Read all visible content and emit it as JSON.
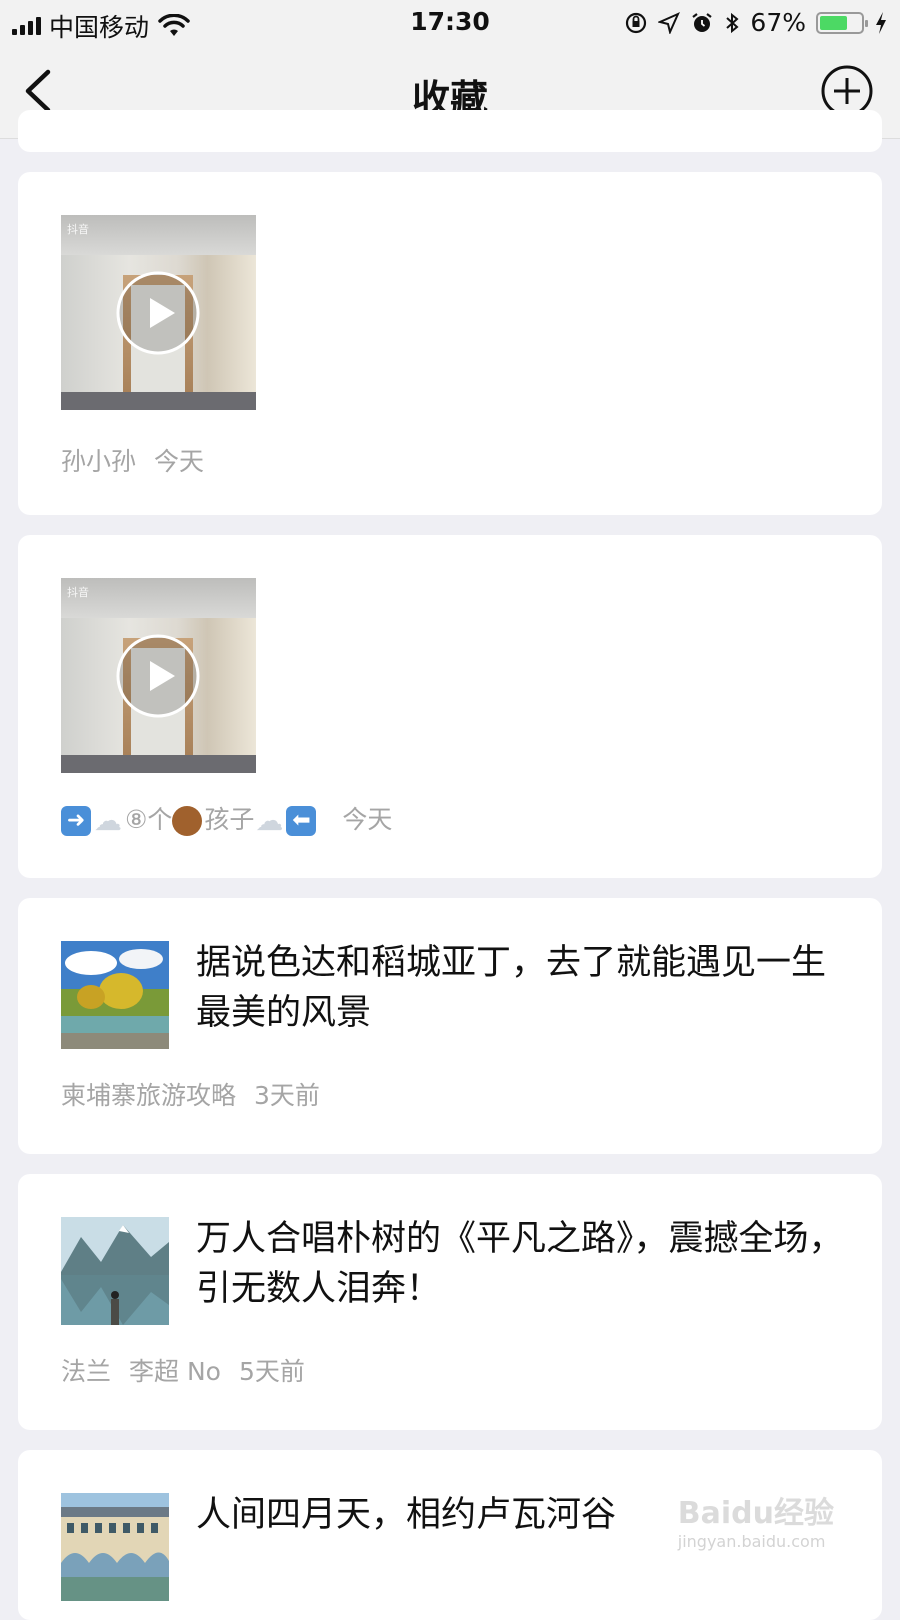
{
  "status_bar": {
    "carrier": "中国移动",
    "time": "17:30",
    "battery": "67%",
    "battery_level": 0.67
  },
  "nav": {
    "title": "收藏"
  },
  "items": [
    {
      "type": "video",
      "thumb_watermark": "抖音",
      "author": "孙小孙",
      "time": "今天"
    },
    {
      "type": "video",
      "thumb_watermark": "抖音",
      "author_text": "⑧个",
      "author_text2": "孩子",
      "time": "今天"
    },
    {
      "type": "article",
      "title": "据说色达和稻城亚丁，去了就能遇见一生最美的风景",
      "source": "柬埔寨旅游攻略",
      "time": "3天前"
    },
    {
      "type": "article",
      "title": "万人合唱朴树的《平凡之路》，震撼全场，引无数人泪奔！",
      "source": "法兰",
      "author": "李超 No",
      "time": "5天前"
    },
    {
      "type": "article",
      "title": "人间四月天，相约卢瓦河谷"
    }
  ],
  "watermark": {
    "main": "Baidu经验",
    "sub": "jingyan.baidu.com"
  },
  "colors": {
    "background": "#efeff4",
    "meta_text": "#a5a5a5",
    "battery_green": "#4cd964"
  }
}
